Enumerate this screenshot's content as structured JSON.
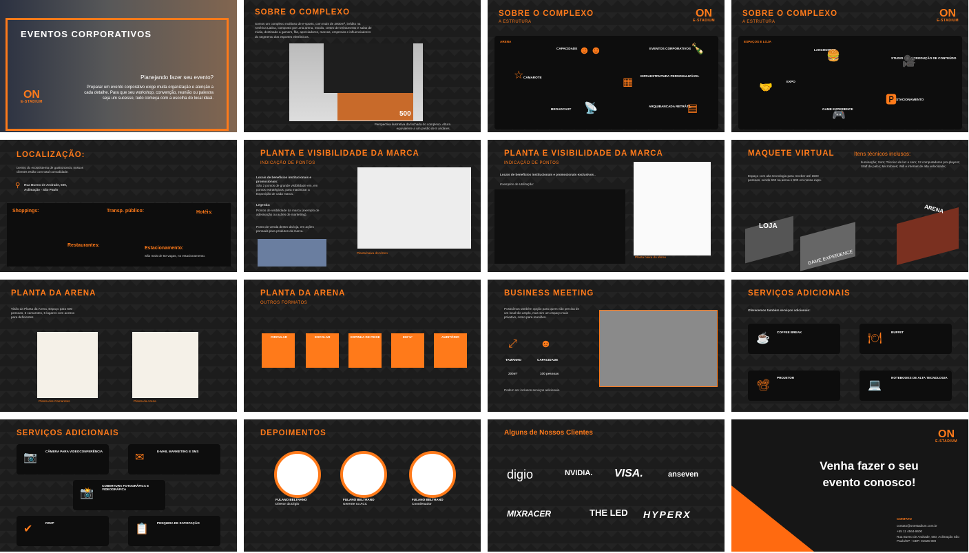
{
  "s1": {
    "title": "EVENTOS CORPORATIVOS",
    "question": "Planejando fazer seu evento?",
    "body": "Preparar um evento corporativo exige muita organização e atenção a cada detalhe. Para que seu workshop, convenção, reunião ou palestra seja um sucesso, tudo começa com a escolha do local ideal.",
    "logo_on": "ON",
    "logo_es": "E-STADIUM"
  },
  "s2": {
    "title": "SOBRE O COMPLEXO",
    "body": "Somos um complexo multiuso de e-sports, com mais de 3000m², inédito na América Latina, composto por uma arena, escola, centro de treinamento e salas de mídia, destinado a gamers, fãs, apreciadores, marcas, empresas e influenciadores do segmento dos esportes eletrônicos.",
    "caption": "Perspectiva ilustrativa da fachada do complexo. Altura equivalente a um prédio de 8 andares.",
    "badge": "500"
  },
  "s3": {
    "title": "SOBRE O COMPLEXO",
    "subtitle": "A ESTRUTURA",
    "section": "ARENA",
    "items": [
      {
        "label": "CAPACIDADE",
        "text": "Temos capacidade para atender até 600 pessoas sentadas em nossa arena."
      },
      {
        "label": "EVENTOS CORPORATIVOS",
        "text": "Todos do fim de ano / Premiações / Coquetéis / Shows / Convenções / Workshops de vendas / Lançamentos de Produtos / Summits"
      },
      {
        "label": "CAMAROTE",
        "text": "Possuímos 9 camarotes com capacidade de até 11 pessoas."
      },
      {
        "label": "INFRAESTRUTURA PERSONALIZÁVEL",
        "text": "Temos as melhores soluções em áudio, iluminação e alta tecnologia."
      },
      {
        "label": "BROADCAST",
        "text": "Nossa estrutura para fazer transmissões ao vivo de eventos."
      },
      {
        "label": "ARQUIBANCADA RETRÁTIL",
        "text": "A arquibancada retrátil é adaptável para vários tipos de eventos."
      }
    ]
  },
  "s4": {
    "title": "SOBRE O COMPLEXO",
    "subtitle": "A ESTRUTURA",
    "section": "ESPAÇOS E LOJA",
    "items": [
      {
        "label": "LANCHONETE",
        "text": "O melhor hamburguer de São Paulo."
      },
      {
        "label": "STUDIO PARA PRODUÇÃO DE CONTEÚDO",
        "text": "Área dedicada à produção de conteúdo."
      },
      {
        "label": "EXPO",
        "text": "Temos um espaço de mais de 100m² dedicado para feiras."
      },
      {
        "label": "ESTACIONAMENTO",
        "text": "São mais de 50 vagas de estacionamento."
      },
      {
        "label": "GAME EXPERIENCE",
        "text": "Oferece para os seus convidados a melhor experiência gamer."
      }
    ]
  },
  "s5": {
    "title": "LOCALIZAÇÃO:",
    "body": "Dentro do ecossistema de gastronomia, nossos clientes estão com total comodidade.",
    "address1": "Rua Bueno de Andrade, 500,",
    "address2": "Aclimação - São Paulo",
    "shop": "Shoppings:",
    "transp": "Transp. público:",
    "hotels": "Hotéis:",
    "rest": "Restaurantes:",
    "park": "Estacionamento:",
    "park_text": "São mais de 50 vagas, no estacionamento."
  },
  "s6": {
    "title": "PLANTA E VISIBILIDADE DA MARCA",
    "subtitle": "INDICAÇÃO DE PONTOS",
    "locais": "Locais de benefícios institucionais e promocionais:",
    "body": "São 2 pontos de grande visibilidade em, em pontos estratégicos, para maximizar a Exposição de cada marca.",
    "legend": "Legenda:",
    "l1": "Pontos de visibilidade da marca (exemplo de adesivação ou ações de marketing).",
    "l2": "Ponto de venda dentro da loja, em ações pontuais para produtos da marca.",
    "caption": "Planta baixa do  térreo"
  },
  "s7": {
    "title": "PLANTA E VISIBILIDADE DA MARCA",
    "subtitle": "INDICAÇÃO DE PONTOS",
    "heading": "Locais de benefícios institucionais e promocionais exclusivos .",
    "examples": "Exemplos de Utilização:",
    "caption": "Planta baixa do  térreo"
  },
  "s8": {
    "title": "MAQUETE VIRTUAL",
    "body": "Espaço com alta tecnologia para receber até 1500 pessoas, sendo 600 na arena e 900 em nossa expo.",
    "tech_title": "Itens técnicos inclusos:",
    "tech": "Iluminação; Som; Técnico de luz e som; 12 computadores pro-players; Staff de palco; Microfones; Wifi e internet de alta velocidade;",
    "loja": "LOJA",
    "arena": "ARENA",
    "game": "GAME EXPERIENCE"
  },
  "s9": {
    "title": "PLANTA DA ARENA",
    "body": "Visão da Planta da Arena, Espaço para 600 pessoas, 5 camarotes, 5 lugares com acesso para deficientes",
    "cap1": "Planta dos Camarotes",
    "cap2": "Planta da Arena"
  },
  "s10": {
    "title": "PLANTA DA ARENA",
    "subtitle": "OUTROS FORMATOS",
    "formats": [
      "CIRCULAR",
      "ESCOLAR",
      "ESPINHA DE PEIXE",
      "EM 'U'",
      "AUDITÓRIO"
    ]
  },
  "s11": {
    "title": "BUSINESS MEETING",
    "body": "Possuímos também opção para quem não precisa de um local tão amplo, mas sim um espaço mais privativo, como para reuniões.",
    "size": "TAMANHO",
    "cap": "CAPACIDADE",
    "size_val": "200m²",
    "cap_val": "100 pessoas",
    "foot": "Podem ser inclusos serviços adicionais."
  },
  "s12": {
    "title": "SERVIÇOS ADICIONAIS",
    "intro": "Oferecemos também serviços adicionais:",
    "cards": [
      {
        "label": "COFFEE BREAK",
        "text": "Welcome Coffee, Coffee Break, Coquetéis e Brunch para o seu evento."
      },
      {
        "label": "BUFFET",
        "text": "Temos parceiros de qualidade e preços variados para você realizar o seu evento."
      },
      {
        "label": "PROJETOR",
        "text": "Locação de Projetor. Qualidade, tecnologia, agilidade e economia para você e seu evento."
      },
      {
        "label": "NOTEBOOKS DE ALTA TECNOLOGIA",
        "text": "Os melhores notebooks do mercado, com a melhor performance."
      }
    ]
  },
  "s13": {
    "title": "SERVIÇOS ADICIONAIS",
    "cards": [
      {
        "label": "CÂMERA PARA VIDEOCONFERÊNCIA",
        "text": "Câmeras para videoconferência, profissionais."
      },
      {
        "label": "E-MAIL MARKETING E SMS",
        "text": "Disparos de uma ferramenta de e-mail marketing e SMS."
      },
      {
        "label": "COBERTURA FOTOGRÁFICA E VIDEOGRÁFICA",
        "text": "Eternize o seu evento com nossos fotógrafos."
      },
      {
        "label": "RSVP",
        "text": "Oferecemos RSVP com contagem regressiva."
      },
      {
        "label": "PESQUISA DE SATISFAÇÃO",
        "text": "Entregamos uma pesquisa de satisfação."
      }
    ]
  },
  "s14": {
    "title": "DEPOIMENTOS",
    "people": [
      {
        "name": "FULANO BELTRANO",
        "role": "Diretor da Digio"
      },
      {
        "name": "FULANO BELTRANO",
        "role": "Gerente na ACC"
      },
      {
        "name": "FULANO BELTRANO",
        "role": "Coordenador"
      }
    ]
  },
  "s15": {
    "title": "Alguns de Nossos Clientes",
    "clients": [
      "digio",
      "NVIDIA.",
      "VISA.",
      "anseven",
      "MIXRACER",
      "THE LED",
      "HYPERX"
    ]
  },
  "s16": {
    "line1": "Venha fazer o seu",
    "line2": "evento conosco!",
    "contato": "CONTATO",
    "email": "contato@onestadium.com.br",
    "phone": "+55 11 4564-9600",
    "addr": "Rua Bueno de Andrade, 500, Aclimação São Paulo/SP - CEP: 01526-000",
    "logo_on": "ON",
    "logo_es": "E-STADIUM"
  },
  "colors": {
    "accent": "#ff7a1a",
    "bg": "#1c1c1c"
  }
}
